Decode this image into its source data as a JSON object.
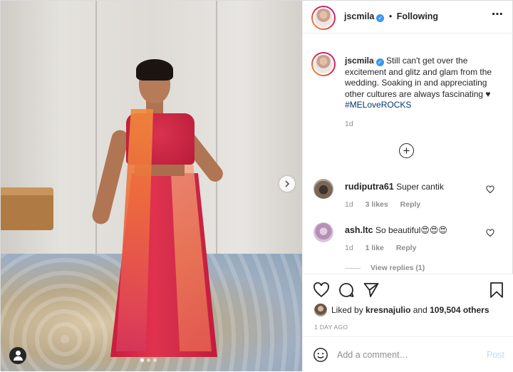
{
  "post": {
    "username": "jscmila",
    "follow_status": "Following",
    "separator": "•",
    "more_icon": "⋯",
    "caption_text": "Still can't get over the excitement and glitz and glam from the wedding. Soaking in and appreciating other cultures are always fascinating ♥ ",
    "hashtag": "#MELoveROCKS",
    "caption_time": "1d",
    "load_more": "+"
  },
  "comments": [
    {
      "username": "rudiputra61",
      "text": "Super cantik",
      "time": "1d",
      "likes": "3 likes",
      "reply": "Reply"
    },
    {
      "username": "ash.ltc",
      "text": "So beautiful😍😍😍",
      "time": "1d",
      "likes": "1 like",
      "reply": "Reply"
    }
  ],
  "view_replies": "View replies (1)",
  "likes": {
    "prefix": "Liked by",
    "user": "kresnajulio",
    "connector": "and",
    "others": "109,504 others"
  },
  "time_ago": "1 DAY AGO",
  "comment_input": {
    "placeholder": "Add a comment…",
    "post_label": "Post"
  },
  "carousel": {
    "dots": 3,
    "active": 1
  },
  "colors": {
    "verified": "#3897f0",
    "hashtag": "#00376b",
    "post_button": "#b2dffc"
  }
}
